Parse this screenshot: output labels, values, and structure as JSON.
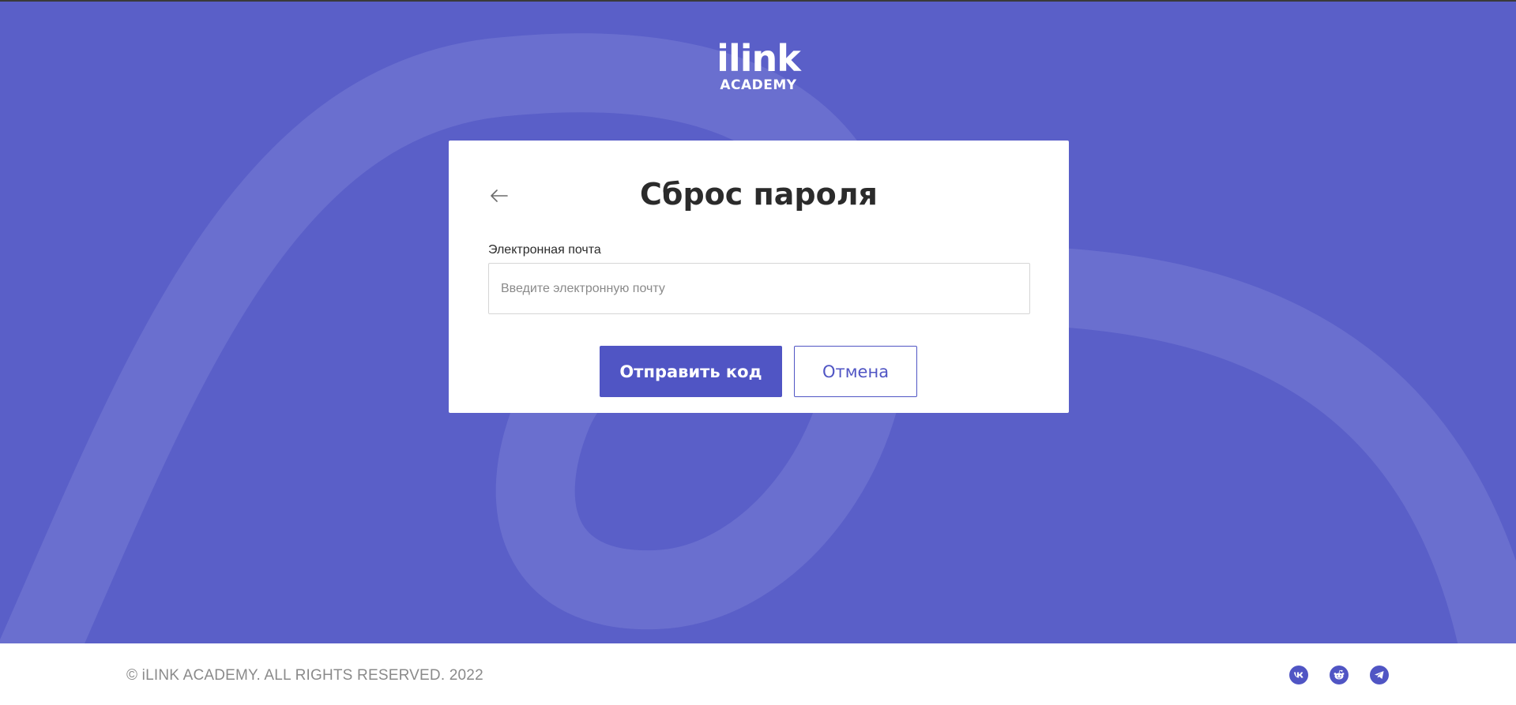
{
  "logo": {
    "line1": "ilink",
    "line2": "ACADEMY"
  },
  "card": {
    "title": "Сброс пароля",
    "back_icon": "arrow-left-icon",
    "email": {
      "label": "Электронная почта",
      "placeholder": "Введите электронную почту",
      "value": ""
    },
    "submit_label": "Отправить код",
    "cancel_label": "Отмена"
  },
  "footer": {
    "copyright": "© iLINK ACADEMY. ALL RIGHTS RESERVED. 2022",
    "socials": [
      {
        "icon": "vk-icon"
      },
      {
        "icon": "reddit-icon"
      },
      {
        "icon": "telegram-icon"
      }
    ]
  },
  "colors": {
    "background": "#5a5fc8",
    "accent": "#5055c4",
    "text": "#2b2b2b",
    "muted": "#8a8a8a"
  }
}
